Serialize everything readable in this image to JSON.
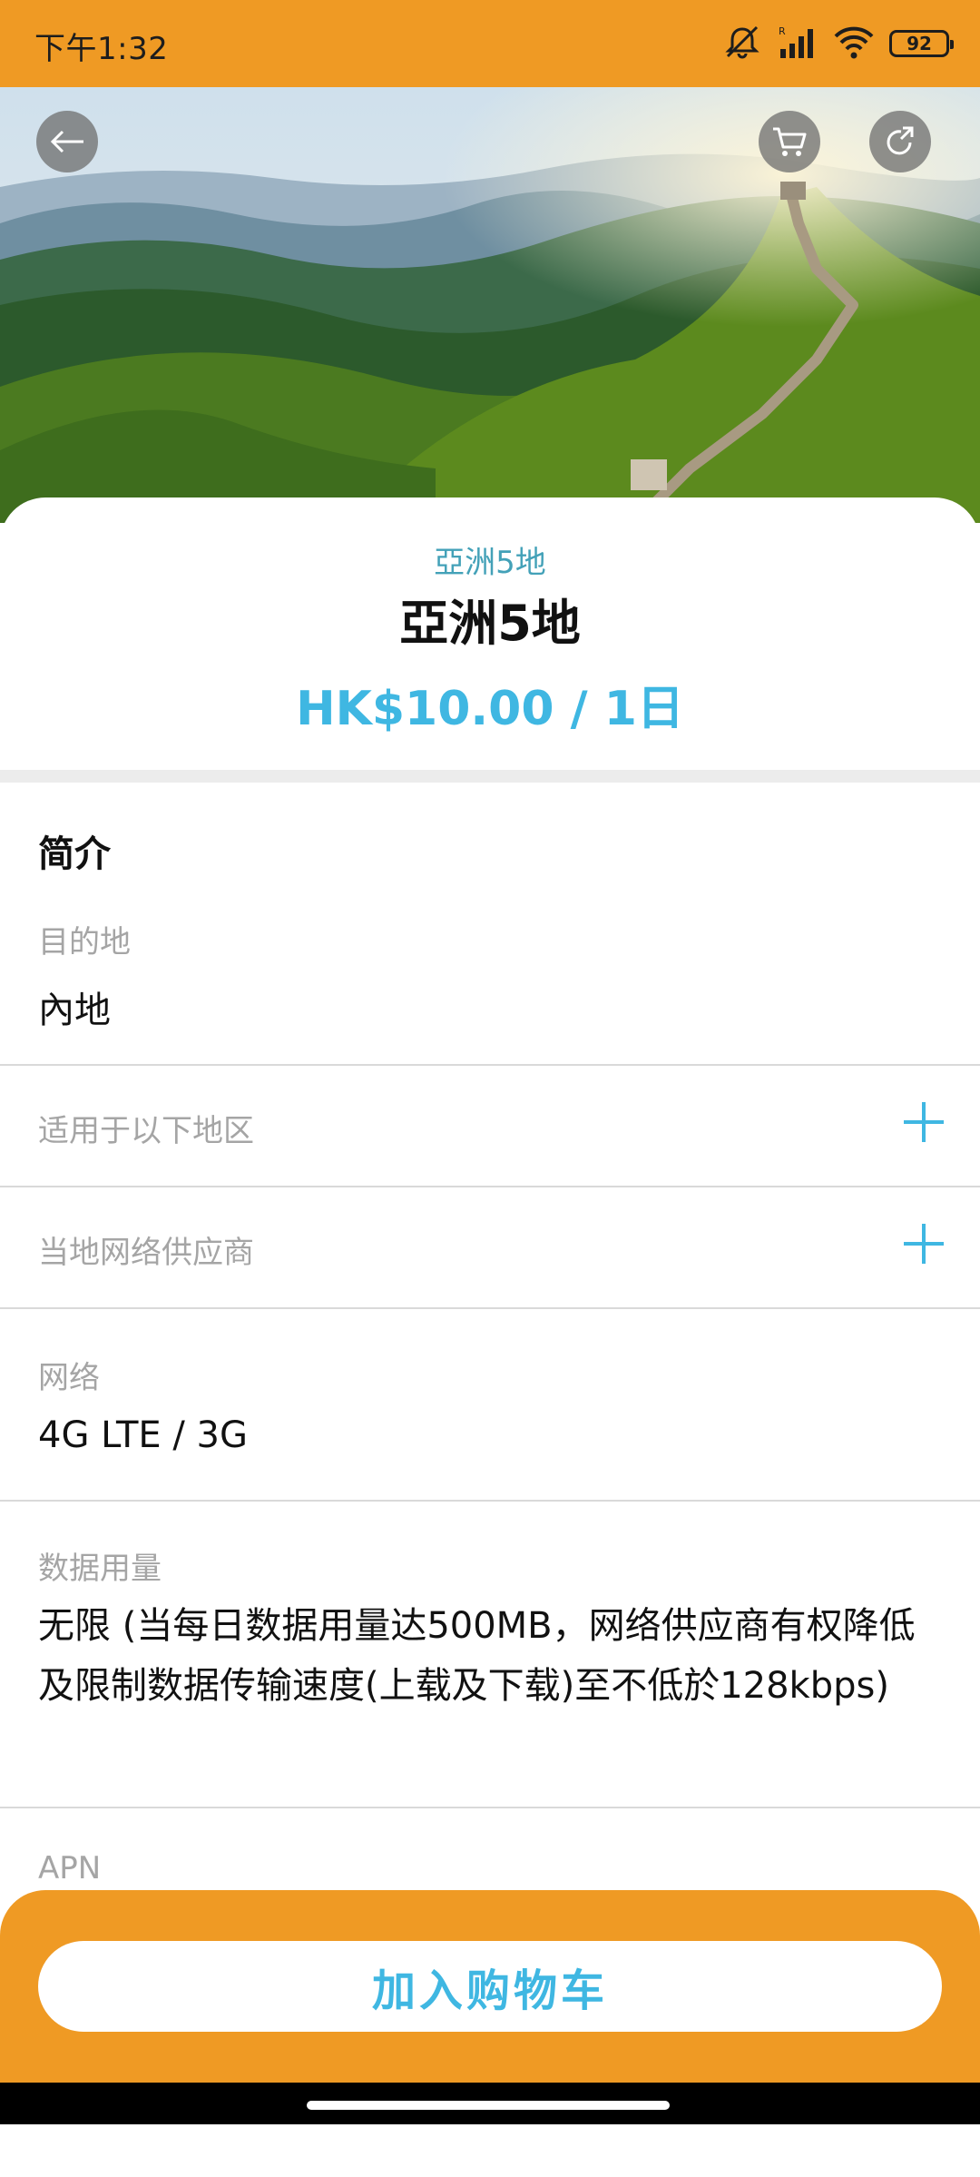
{
  "status_bar": {
    "time": "下午1:32",
    "battery": "92",
    "icons": [
      "mute-icon",
      "signal-icon",
      "wifi-icon",
      "battery-icon"
    ]
  },
  "header": {
    "icons": [
      "back-arrow-icon",
      "cart-icon",
      "share-icon"
    ]
  },
  "product": {
    "subtitle": "亞洲5地",
    "title": "亞洲5地",
    "price": "HK$10.00 / 1日"
  },
  "details": {
    "section_title": "简介",
    "destination_label": "目的地",
    "destination_value": "內地",
    "regions_label": "适用于以下地区",
    "carriers_label": "当地网络供应商",
    "network_label": "网络",
    "network_value": "4G LTE / 3G",
    "data_label": "数据用量",
    "data_value": "无限 (当每日数据用量达500MB，网络供应商有权降低及限制数据传输速度(上载及下载)至不低於128kbps)",
    "apn_label": "APN"
  },
  "cta": {
    "label": "加入购物车"
  },
  "colors": {
    "accent_orange": "#ef9a24",
    "accent_blue": "#3fb7e2",
    "subtitle_teal": "#43a1b8"
  }
}
